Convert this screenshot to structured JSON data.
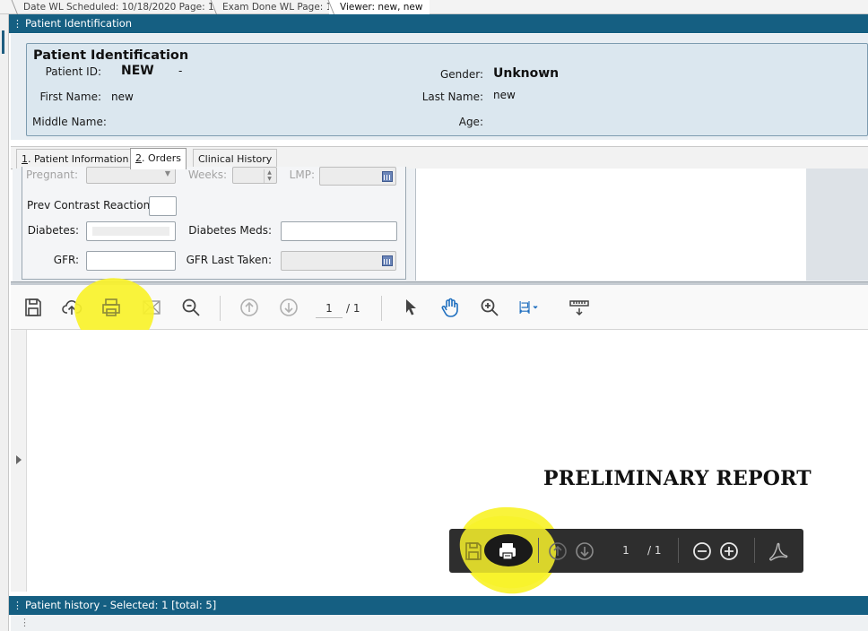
{
  "top_tabs": [
    {
      "label": "Date WL Scheduled: 10/18/2020 Page: 1"
    },
    {
      "label": "Exam Done WL Page: 1"
    },
    {
      "label": "Viewer: new, new"
    }
  ],
  "header_bar": {
    "title": "Patient Identification"
  },
  "patient": {
    "section_title": "Patient Identification",
    "id_label": "Patient ID:",
    "id_value": "NEW",
    "id_suffix": "-",
    "first_name_label": "First Name:",
    "first_name_value": "new",
    "middle_name_label": "Middle Name:",
    "gender_label": "Gender:",
    "gender_value": "Unknown",
    "last_name_label": "Last Name:",
    "last_name_value": "new",
    "age_label": "Age:"
  },
  "detail_tabs": [
    {
      "hotkey": "1",
      "rest": ". Patient Information"
    },
    {
      "hotkey": "2",
      "rest": ". Orders"
    },
    {
      "hotkey": "",
      "rest": "Clinical History"
    }
  ],
  "orders_form": {
    "pregnant_label": "Pregnant:",
    "weeks_label": "Weeks:",
    "lmp_label": "LMP:",
    "prev_contrast_label": "Prev Contrast Reaction",
    "diabetes_label": "Diabetes:",
    "diabetes_meds_label": "Diabetes Meds:",
    "gfr_label": "GFR:",
    "gfr_last_taken_label": "GFR Last Taken:"
  },
  "pdf_toolbar": {
    "icons": [
      "save-icon",
      "upload-icon",
      "print-icon",
      "email-icon",
      "search-icon",
      "prev-page-icon",
      "next-page-icon",
      "select-cursor-icon",
      "hand-pan-icon",
      "zoom-in-icon",
      "fit-page-icon",
      "annotate-icon"
    ],
    "page_current": "1",
    "page_total": "/ 1"
  },
  "document": {
    "title": "PRELIMINARY REPORT"
  },
  "floating_toolbar": {
    "icons": [
      "save-icon",
      "print-icon",
      "prev-page-icon",
      "next-page-icon",
      "zoom-out-icon",
      "zoom-in-icon",
      "acrobat-icon"
    ],
    "page_current": "1",
    "page_total": "/ 1"
  },
  "status_bar": {
    "text": "Patient history - Selected: 1 [total: 5]"
  },
  "colors": {
    "teal": "#155f82",
    "highlight": "#f8f22a",
    "toolbar_dark": "#2e2e2e",
    "accent_blue": "#1f6fbf"
  }
}
